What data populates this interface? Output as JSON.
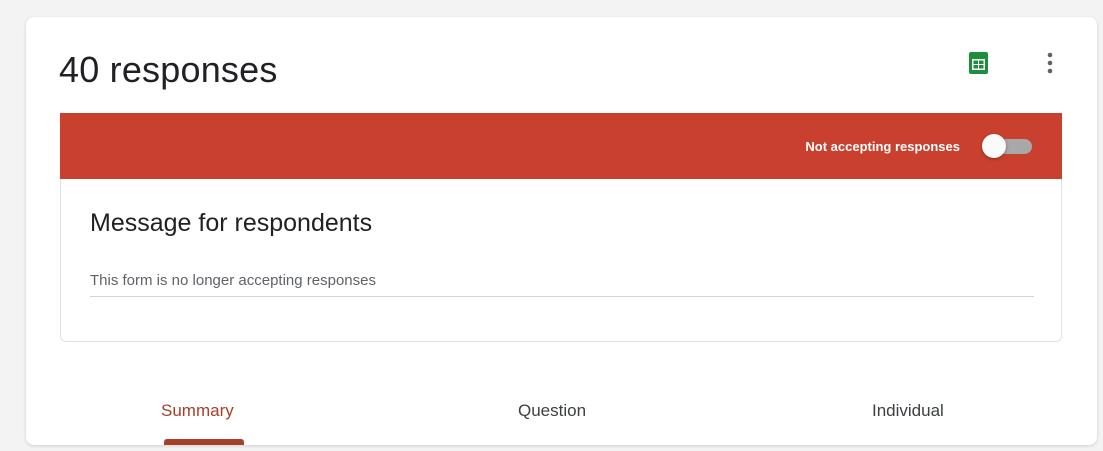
{
  "header": {
    "title": "40 responses",
    "sheets_icon": "google-sheets-icon",
    "more_icon": "more-vert-icon"
  },
  "banner": {
    "label": "Not accepting responses",
    "accepting_responses": false,
    "color": "#c9402f"
  },
  "message": {
    "heading": "Message for respondents",
    "value": "This form is no longer accepting responses"
  },
  "tabs": {
    "items": [
      {
        "label": "Summary",
        "active": true
      },
      {
        "label": "Question",
        "active": false
      },
      {
        "label": "Individual",
        "active": false
      }
    ],
    "accent": "#a5402a"
  }
}
